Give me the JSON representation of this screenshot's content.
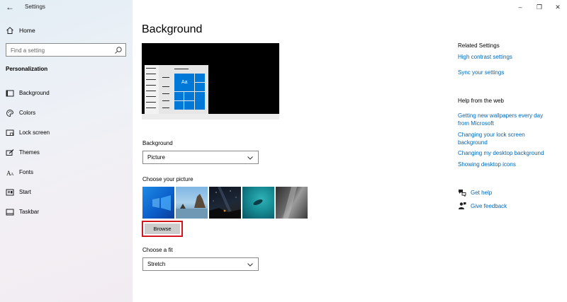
{
  "window": {
    "title": "Settings",
    "controls": {
      "minimize": "–",
      "restore": "❐",
      "close": "✕"
    }
  },
  "sidebar": {
    "home_label": "Home",
    "search_placeholder": "Find a setting",
    "section_title": "Personalization",
    "items": [
      {
        "label": "Background",
        "icon": "picture-icon"
      },
      {
        "label": "Colors",
        "icon": "palette-icon"
      },
      {
        "label": "Lock screen",
        "icon": "lock-screen-icon"
      },
      {
        "label": "Themes",
        "icon": "brush-icon"
      },
      {
        "label": "Fonts",
        "icon": "font-icon"
      },
      {
        "label": "Start",
        "icon": "start-icon"
      },
      {
        "label": "Taskbar",
        "icon": "taskbar-icon"
      }
    ]
  },
  "main": {
    "title": "Background",
    "preview_sample_text": "Aa",
    "background_label": "Background",
    "background_value": "Picture",
    "choose_picture_label": "Choose your picture",
    "browse_label": "Browse",
    "choose_fit_label": "Choose a fit",
    "fit_value": "Stretch"
  },
  "right": {
    "related_title": "Related Settings",
    "related_links": [
      "High contrast settings",
      "Sync your settings"
    ],
    "help_title": "Help from the web",
    "help_links": [
      "Getting new wallpapers every day from Microsoft",
      "Changing your lock screen background",
      "Changing my desktop background",
      "Showing desktop icons"
    ],
    "get_help": "Get help",
    "give_feedback": "Give feedback"
  }
}
